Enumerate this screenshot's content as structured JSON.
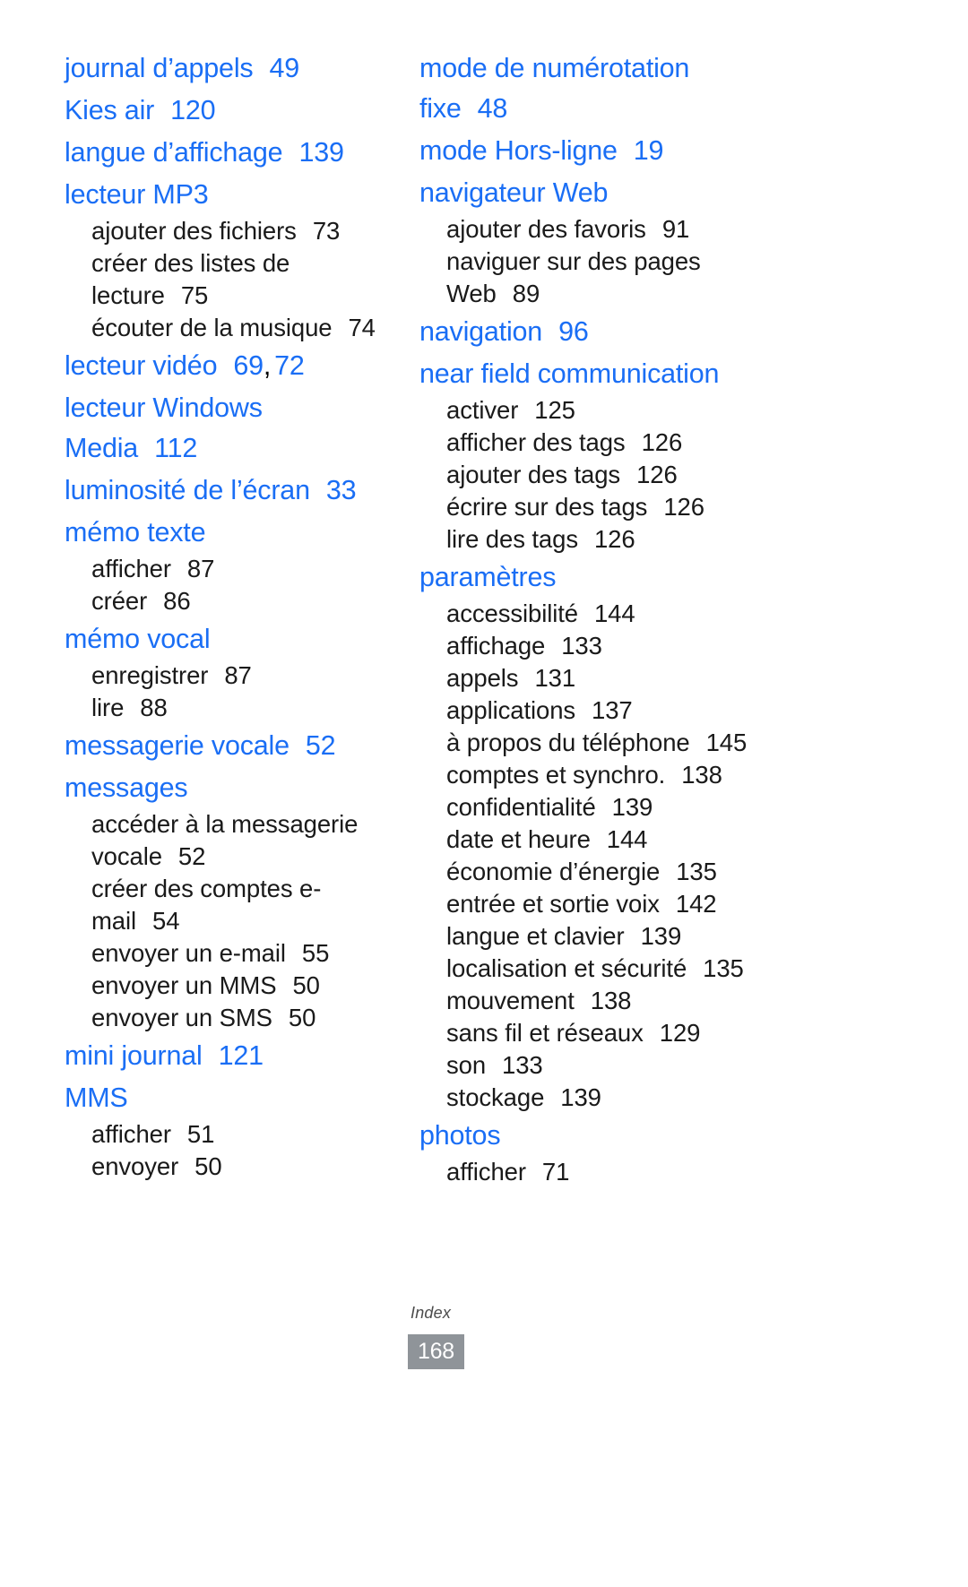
{
  "document": {
    "footer_label": "Index",
    "footer_page_number": "168",
    "accent_color": "#1a6ef5",
    "badge_color": "#8f9499",
    "body_color": "#1a1a1a"
  },
  "left_column": [
    {
      "type": "entry",
      "label": "journal d’appels",
      "page": "49"
    },
    {
      "type": "entry",
      "label": "Kies air",
      "page": "120"
    },
    {
      "type": "entry",
      "label": "langue d’affichage",
      "page": "139"
    },
    {
      "type": "entry",
      "label": "lecteur MP3",
      "page": ""
    },
    {
      "type": "sub",
      "label": "ajouter des fichiers",
      "page": "73"
    },
    {
      "type": "sub",
      "label": "créer des listes de lecture",
      "page": "75"
    },
    {
      "type": "sub",
      "label": "écouter de la musique",
      "page": "74"
    },
    {
      "type": "entry",
      "label": "lecteur vidéo",
      "page": "69",
      "page2": "72",
      "sep": ","
    },
    {
      "type": "entry",
      "label": "lecteur Windows Media",
      "page": "112"
    },
    {
      "type": "entry",
      "label": "luminosité de l’écran",
      "page": "33"
    },
    {
      "type": "entry",
      "label": "mémo texte",
      "page": ""
    },
    {
      "type": "sub",
      "label": "afficher",
      "page": "87"
    },
    {
      "type": "sub",
      "label": "créer",
      "page": "86"
    },
    {
      "type": "entry",
      "label": "mémo vocal",
      "page": ""
    },
    {
      "type": "sub",
      "label": "enregistrer",
      "page": "87"
    },
    {
      "type": "sub",
      "label": "lire",
      "page": "88"
    },
    {
      "type": "entry",
      "label": "messagerie vocale",
      "page": "52"
    },
    {
      "type": "entry",
      "label": "messages",
      "page": ""
    },
    {
      "type": "sub",
      "label": "accéder à la messagerie vocale",
      "page": "52"
    },
    {
      "type": "sub",
      "label": "créer des comptes e-mail",
      "page": "54"
    },
    {
      "type": "sub",
      "label": "envoyer un e-mail",
      "page": "55"
    },
    {
      "type": "sub",
      "label": "envoyer un MMS",
      "page": "50"
    },
    {
      "type": "sub",
      "label": "envoyer un SMS",
      "page": "50"
    },
    {
      "type": "entry",
      "label": "mini journal",
      "page": "121"
    },
    {
      "type": "entry",
      "label": "MMS",
      "page": ""
    },
    {
      "type": "sub",
      "label": "afficher",
      "page": "51"
    },
    {
      "type": "sub",
      "label": "envoyer",
      "page": "50"
    }
  ],
  "right_column": [
    {
      "type": "entry",
      "label": "mode de numérotation fixe",
      "page": "48"
    },
    {
      "type": "entry",
      "label": "mode Hors-ligne",
      "page": "19"
    },
    {
      "type": "entry",
      "label": "navigateur Web",
      "page": ""
    },
    {
      "type": "sub",
      "label": "ajouter des favoris",
      "page": "91"
    },
    {
      "type": "sub",
      "label": "naviguer sur des pages Web",
      "page": "89"
    },
    {
      "type": "entry",
      "label": "navigation",
      "page": "96"
    },
    {
      "type": "entry",
      "label": "near field communication",
      "page": ""
    },
    {
      "type": "sub",
      "label": "activer",
      "page": "125"
    },
    {
      "type": "sub",
      "label": "afficher des tags",
      "page": "126"
    },
    {
      "type": "sub",
      "label": "ajouter des tags",
      "page": "126"
    },
    {
      "type": "sub",
      "label": "écrire sur des tags",
      "page": "126"
    },
    {
      "type": "sub",
      "label": "lire des tags",
      "page": "126"
    },
    {
      "type": "entry",
      "label": "paramètres",
      "page": ""
    },
    {
      "type": "sub",
      "label": "accessibilité",
      "page": "144"
    },
    {
      "type": "sub",
      "label": "affichage",
      "page": "133"
    },
    {
      "type": "sub",
      "label": "appels",
      "page": "131"
    },
    {
      "type": "sub",
      "label": "applications",
      "page": "137"
    },
    {
      "type": "sub",
      "label": "à propos du téléphone",
      "page": "145"
    },
    {
      "type": "sub",
      "label": "comptes et synchro.",
      "page": "138"
    },
    {
      "type": "sub",
      "label": "confidentialité",
      "page": "139"
    },
    {
      "type": "sub",
      "label": "date et heure",
      "page": "144"
    },
    {
      "type": "sub",
      "label": "économie d’énergie",
      "page": "135"
    },
    {
      "type": "sub",
      "label": "entrée et sortie voix",
      "page": "142"
    },
    {
      "type": "sub",
      "label": "langue et clavier",
      "page": "139"
    },
    {
      "type": "sub",
      "label": "localisation et sécurité",
      "page": "135"
    },
    {
      "type": "sub",
      "label": "mouvement",
      "page": "138"
    },
    {
      "type": "sub",
      "label": "sans fil et réseaux",
      "page": "129"
    },
    {
      "type": "sub",
      "label": "son",
      "page": "133"
    },
    {
      "type": "sub",
      "label": "stockage",
      "page": "139"
    },
    {
      "type": "entry",
      "label": "photos",
      "page": ""
    },
    {
      "type": "sub",
      "label": "afficher",
      "page": "71"
    }
  ]
}
